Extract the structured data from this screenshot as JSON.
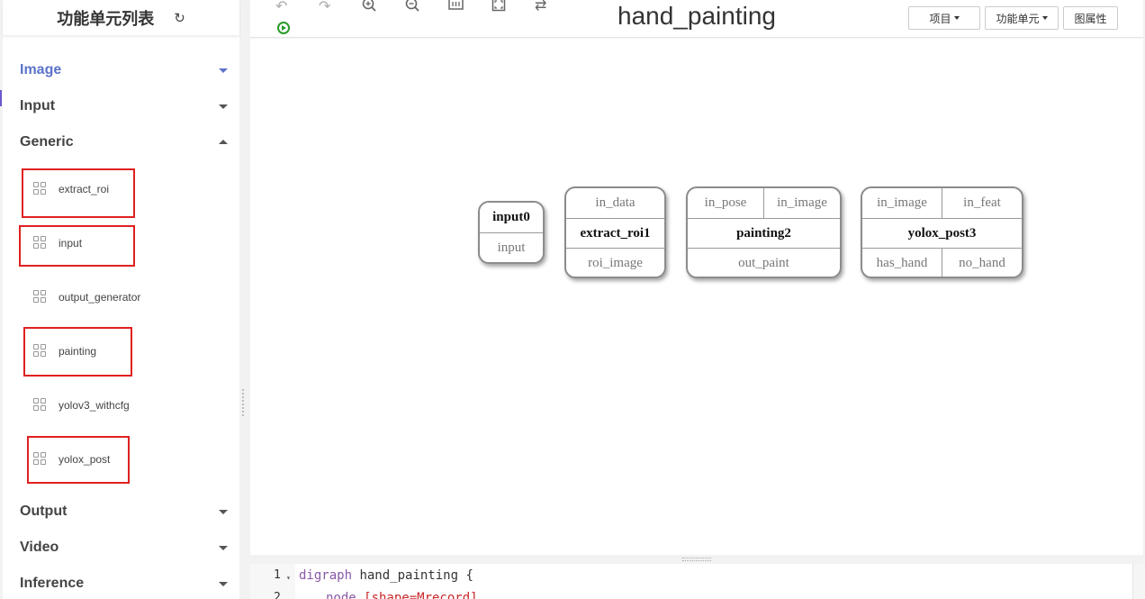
{
  "sidebar": {
    "title": "功能单元列表",
    "refresh_icon": "refresh-icon",
    "categories": {
      "image": "Image",
      "input": "Input",
      "generic": "Generic",
      "output": "Output",
      "video": "Video",
      "inference": "Inference"
    },
    "generic_items": [
      "extract_roi",
      "input",
      "output_generator",
      "painting",
      "yolov3_withcfg",
      "yolox_post"
    ],
    "accent_color": "#5b73c9",
    "highlight_color": "#e02020"
  },
  "toolbar": {
    "icons": [
      "undo-icon",
      "redo-icon",
      "zoom-in-icon",
      "zoom-out-icon",
      "fit-width-icon",
      "fullscreen-icon",
      "swap-icon",
      "run-icon"
    ],
    "graph_title": "hand_painting",
    "project_menu": "项目",
    "unit_menu": "功能单元",
    "properties_button": "图属性"
  },
  "graph": {
    "nodes": [
      {
        "name": "input0",
        "inputs": [],
        "outputs": [
          "input"
        ]
      },
      {
        "name": "extract_roi1",
        "inputs": [
          "in_data"
        ],
        "outputs": [
          "roi_image"
        ]
      },
      {
        "name": "painting2",
        "inputs": [
          "in_pose",
          "in_image"
        ],
        "outputs": [
          "out_paint"
        ]
      },
      {
        "name": "yolox_post3",
        "inputs": [
          "in_image",
          "in_feat"
        ],
        "outputs": [
          "has_hand",
          "no_hand"
        ]
      }
    ]
  },
  "editor": {
    "lines": [
      {
        "number": "1",
        "keyword": "digraph",
        "text": " hand_painting {"
      },
      {
        "number": "2",
        "keyword": "node",
        "text": " [shape=Mrecord]"
      }
    ]
  }
}
